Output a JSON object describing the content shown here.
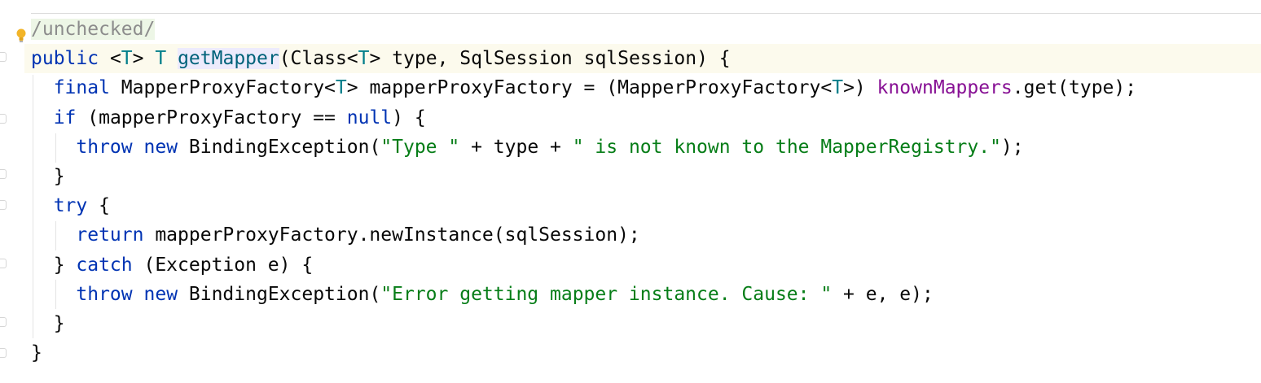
{
  "editor": {
    "language": "java",
    "colors": {
      "keyword": "#0033b3",
      "string": "#067d17",
      "method": "#00627a",
      "field": "#871094",
      "type_param": "#007e8a",
      "text": "#080808",
      "current_line": "#fcfaed",
      "annotation_bg": "#edf6e6"
    },
    "gutter_icon": "lightbulb-icon",
    "lines": [
      [
        {
          "t": "/unchecked/",
          "c": "com",
          "bg": "ann"
        }
      ],
      [
        {
          "t": "public",
          "c": "kw"
        },
        {
          "t": " <",
          "c": "plain"
        },
        {
          "t": "T",
          "c": "tp"
        },
        {
          "t": "> ",
          "c": "plain"
        },
        {
          "t": "T",
          "c": "tp"
        },
        {
          "t": " ",
          "c": "plain"
        },
        {
          "t": "getMapper",
          "c": "fn",
          "bg": "ident"
        },
        {
          "t": "(Class<",
          "c": "plain"
        },
        {
          "t": "T",
          "c": "tp"
        },
        {
          "t": "> type, SqlSession sqlSession) {",
          "c": "plain"
        }
      ],
      [
        {
          "t": "  ",
          "c": "plain"
        },
        {
          "t": "final",
          "c": "kw"
        },
        {
          "t": " MapperProxyFactory<",
          "c": "plain"
        },
        {
          "t": "T",
          "c": "tp"
        },
        {
          "t": "> mapperProxyFactory = (MapperProxyFactory<",
          "c": "plain"
        },
        {
          "t": "T",
          "c": "tp"
        },
        {
          "t": ">) ",
          "c": "plain"
        },
        {
          "t": "knownMappers",
          "c": "field"
        },
        {
          "t": ".get(type);",
          "c": "plain"
        }
      ],
      [
        {
          "t": "  ",
          "c": "plain"
        },
        {
          "t": "if",
          "c": "kw"
        },
        {
          "t": " (mapperProxyFactory == ",
          "c": "plain"
        },
        {
          "t": "null",
          "c": "kw"
        },
        {
          "t": ") {",
          "c": "plain"
        }
      ],
      [
        {
          "t": "    ",
          "c": "plain"
        },
        {
          "t": "throw",
          "c": "kw"
        },
        {
          "t": " ",
          "c": "plain"
        },
        {
          "t": "new",
          "c": "kw"
        },
        {
          "t": " BindingException(",
          "c": "plain"
        },
        {
          "t": "\"Type \"",
          "c": "str"
        },
        {
          "t": " + type + ",
          "c": "plain"
        },
        {
          "t": "\" is not known to the MapperRegistry.\"",
          "c": "str"
        },
        {
          "t": ");",
          "c": "plain"
        }
      ],
      [
        {
          "t": "  }",
          "c": "plain"
        }
      ],
      [
        {
          "t": "  ",
          "c": "plain"
        },
        {
          "t": "try",
          "c": "kw"
        },
        {
          "t": " {",
          "c": "plain"
        }
      ],
      [
        {
          "t": "    ",
          "c": "plain"
        },
        {
          "t": "return",
          "c": "kw"
        },
        {
          "t": " mapperProxyFactory.newInstance(sqlSession);",
          "c": "plain"
        }
      ],
      [
        {
          "t": "  } ",
          "c": "plain"
        },
        {
          "t": "catch",
          "c": "kw"
        },
        {
          "t": " (Exception e) {",
          "c": "plain"
        }
      ],
      [
        {
          "t": "    ",
          "c": "plain"
        },
        {
          "t": "throw",
          "c": "kw"
        },
        {
          "t": " ",
          "c": "plain"
        },
        {
          "t": "new",
          "c": "kw"
        },
        {
          "t": " BindingException(",
          "c": "plain"
        },
        {
          "t": "\"Error getting mapper instance. Cause: \"",
          "c": "str"
        },
        {
          "t": " + e, e);",
          "c": "plain"
        }
      ],
      [
        {
          "t": "  }",
          "c": "plain"
        }
      ],
      [
        {
          "t": "}",
          "c": "plain"
        }
      ]
    ]
  }
}
